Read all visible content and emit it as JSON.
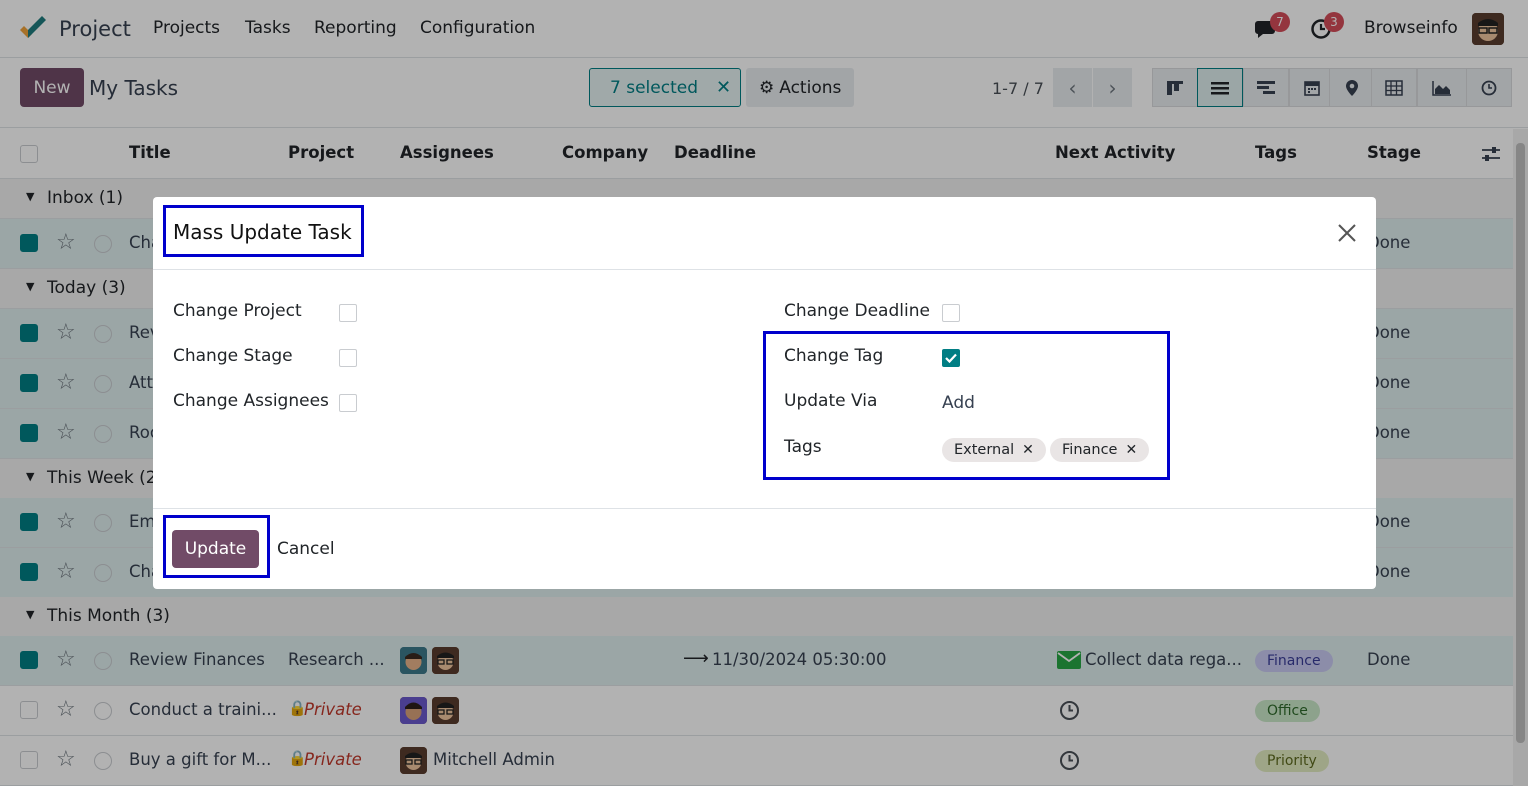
{
  "app": {
    "name": "Project",
    "user": "Browseinfo",
    "messages_count": "7",
    "activities_count": "3"
  },
  "menu": [
    "Projects",
    "Tasks",
    "Reporting",
    "Configuration"
  ],
  "control": {
    "new_label": "New",
    "title": "My Tasks",
    "selected_label": "7 selected",
    "actions_label": "Actions",
    "pager": "1-7 / 7"
  },
  "columns": [
    "Title",
    "Project",
    "Assignees",
    "Company",
    "Deadline",
    "Next Activity",
    "Tags",
    "Stage"
  ],
  "groups": [
    {
      "label": "Inbox (1)"
    },
    {
      "label": "Today (3)"
    },
    {
      "label": "This Week (2)"
    },
    {
      "label": "This Month (3)"
    }
  ],
  "rows_behind": [
    {
      "title": "Cha",
      "stage": "Done"
    },
    {
      "title": "Rev",
      "stage": "Done"
    },
    {
      "title": "Att",
      "stage": "Done"
    },
    {
      "title": "Roo",
      "stage": "Done"
    },
    {
      "title": "Em",
      "stage": "Done"
    },
    {
      "title": "Cha",
      "stage": "Done"
    }
  ],
  "rows": [
    {
      "title": "Review Finances",
      "project": "Research ...",
      "deadline": "11/30/2024 05:30:00",
      "activity": "Collect data rega...",
      "tag": "Finance",
      "stage": "Done"
    },
    {
      "title": "Conduct a traini...",
      "project": "Private",
      "tag": "Office"
    },
    {
      "title": "Buy a gift for M...",
      "project": "Private",
      "assignee": "Mitchell Admin",
      "tag": "Priority"
    }
  ],
  "modal": {
    "title": "Mass Update Task",
    "fields_left": [
      "Change Project",
      "Change Stage",
      "Change Assignees"
    ],
    "change_deadline": "Change Deadline",
    "change_tag": "Change Tag",
    "update_via_label": "Update Via",
    "update_via_value": "Add",
    "tags_label": "Tags",
    "tags": [
      "External",
      "Finance"
    ],
    "update_label": "Update",
    "cancel_label": "Cancel"
  },
  "colors": {
    "brand": "#714b67",
    "teal": "#017e84",
    "highlight": "#0000cc"
  }
}
